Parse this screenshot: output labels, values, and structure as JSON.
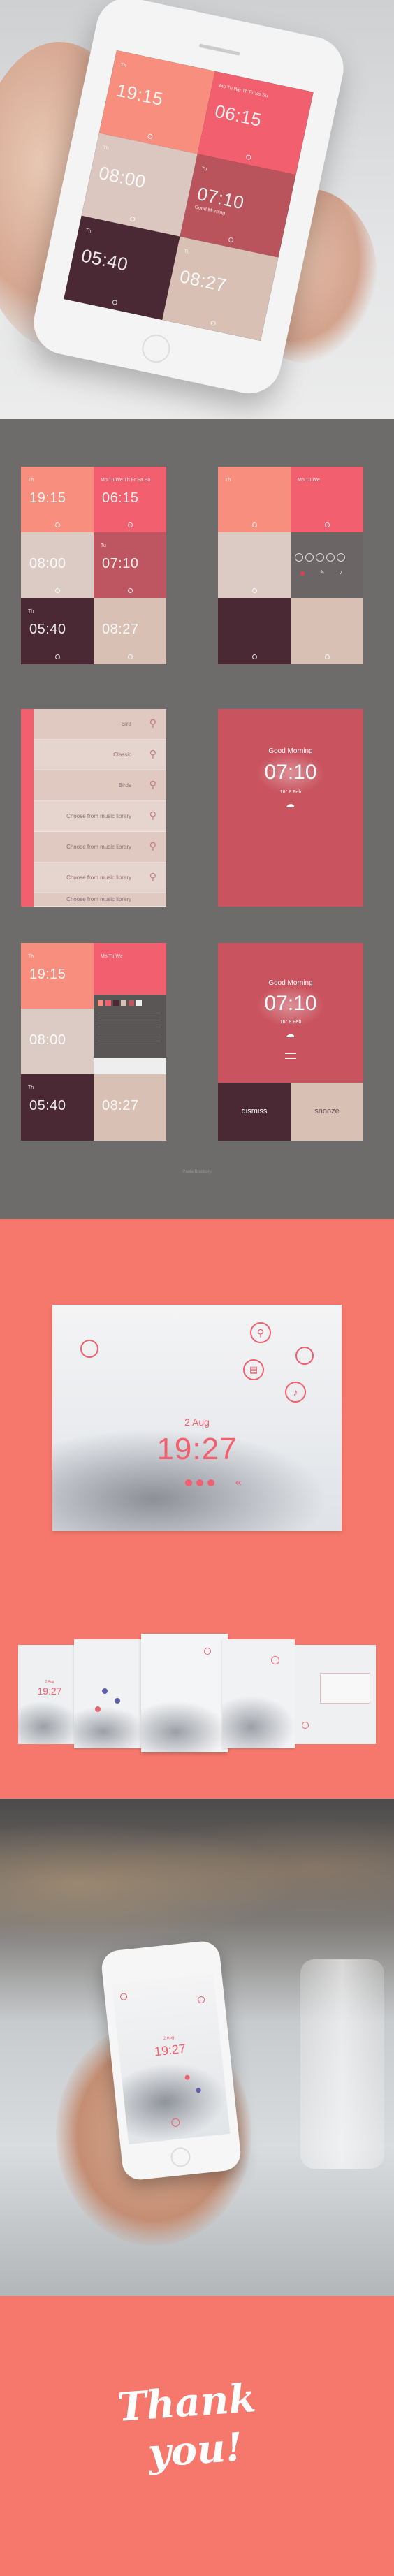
{
  "colors": {
    "salmon": "#f6786c",
    "coral": "#f78e7e",
    "rose": "#de6e79",
    "plum": "#4c2c36",
    "beige": "#d8c0b4",
    "grey": "#6e6b6b",
    "blush": "#f2a5a6"
  },
  "phone": {
    "tiles": [
      {
        "day": "Th",
        "time": "19:15",
        "sub": ""
      },
      {
        "day": "Mo Tu We Th Fr Sa Su",
        "time": "06:15",
        "sub": ""
      },
      {
        "day": "Th",
        "time": "08:00",
        "sub": ""
      },
      {
        "day": "Tu",
        "time": "07:10",
        "sub": "Good Morning"
      },
      {
        "day": "Th",
        "time": "05:40",
        "sub": ""
      },
      {
        "day": "Th",
        "time": "08:27",
        "sub": ""
      }
    ]
  },
  "mock1": {
    "tiles": [
      {
        "day": "Th",
        "time": "19:15"
      },
      {
        "day": "Mo Tu We Th Fr Sa Su",
        "time": "06:15"
      },
      {
        "day": "",
        "time": "08:00"
      },
      {
        "day": "Tu",
        "time": "07:10"
      },
      {
        "day": "Th",
        "time": "05:40"
      },
      {
        "day": "",
        "time": "08:27"
      }
    ]
  },
  "mock2": {
    "tiles": [
      {
        "day": "Th",
        "time": ""
      },
      {
        "day": "Mo Tu We",
        "time": ""
      },
      {
        "day": "",
        "time": ""
      },
      {
        "day": "",
        "time": ""
      },
      {
        "day": "",
        "time": ""
      },
      {
        "day": "",
        "time": ""
      }
    ]
  },
  "mock3": {
    "rows": [
      "Bird",
      "Classic",
      "Birds",
      "Choose from music library",
      "Choose from music library",
      "Choose from music library",
      "Choose from music library"
    ]
  },
  "mock4": {
    "greeting": "Good Morning",
    "time": "07:10",
    "temp": "16° 8 Feb"
  },
  "mock5": {
    "tiles": [
      {
        "day": "Th",
        "time": "19:15"
      },
      {
        "day": "Mo Tu We",
        "time": ""
      },
      {
        "day": "",
        "time": "08:00"
      },
      {
        "day": "",
        "time": ""
      },
      {
        "day": "Th",
        "time": "05:40"
      },
      {
        "day": "",
        "time": "08:27"
      }
    ]
  },
  "mock6": {
    "greeting": "Good Morning",
    "time": "07:10",
    "temp": "16° 8 Feb",
    "dismiss": "dismiss",
    "snooze": "snooze"
  },
  "credit": "Paula Bradbury",
  "cards": {
    "date": "2 Aug",
    "time": "19:27",
    "small_date": "2 Aug",
    "small_time": "19:27"
  },
  "photo_phone": {
    "date": "2 Aug",
    "time": "19:27"
  },
  "thankyou": {
    "line1": "Thank",
    "line2": "you!"
  }
}
